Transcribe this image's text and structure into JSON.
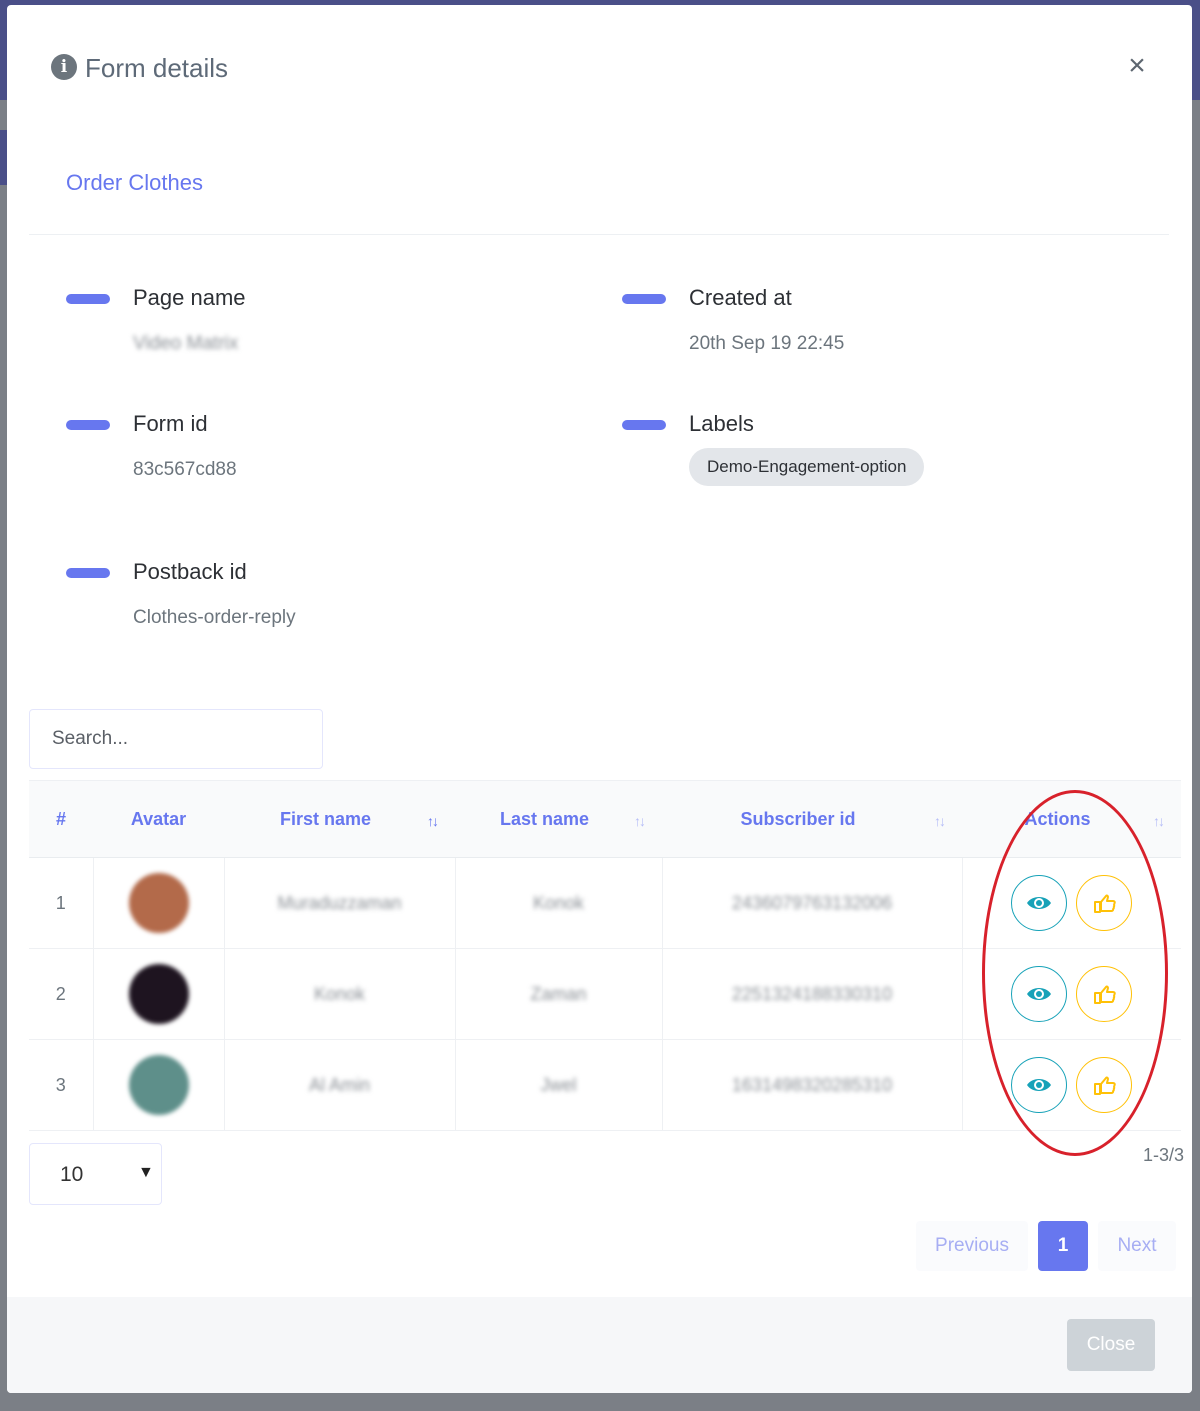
{
  "modal": {
    "title": "Form details",
    "close_symbol": "×",
    "form_name": "Order Clothes"
  },
  "details": {
    "page_name_label": "Page name",
    "page_name_value": "Video Matrix",
    "created_at_label": "Created at",
    "created_at_value": "20th Sep 19 22:45",
    "form_id_label": "Form id",
    "form_id_value": "83c567cd88",
    "labels_label": "Labels",
    "labels_value": "Demo-Engagement-option",
    "postback_label": "Postback id",
    "postback_value": "Clothes-order-reply"
  },
  "search": {
    "placeholder": "Search..."
  },
  "table": {
    "headers": [
      "#",
      "Avatar",
      "First name",
      "Last name",
      "Subscriber id",
      "Actions"
    ],
    "rows": [
      {
        "index": "1",
        "first_name": "Muraduzzaman",
        "last_name": "Konok",
        "subscriber_id": "2436079763132006",
        "avatar_color": "#b36a4a"
      },
      {
        "index": "2",
        "first_name": "Konok",
        "last_name": "Zaman",
        "subscriber_id": "2251324188330310",
        "avatar_color": "#1e1420"
      },
      {
        "index": "3",
        "first_name": "Al Amin",
        "last_name": "Jwel",
        "subscriber_id": "1631498320285310",
        "avatar_color": "#5e8f8a"
      }
    ]
  },
  "pagination": {
    "per_page": "10",
    "range": "1-3/3",
    "previous": "Previous",
    "current": "1",
    "next": "Next"
  },
  "footer": {
    "close_label": "Close"
  },
  "colors": {
    "primary": "#6777ef",
    "info": "#17a2b8",
    "warning": "#ffc107",
    "annotation": "#d8212b"
  },
  "icons": [
    "info-icon",
    "close-icon",
    "eye-icon",
    "hand-pointer-icon",
    "sort-icon",
    "caret-down-icon"
  ]
}
